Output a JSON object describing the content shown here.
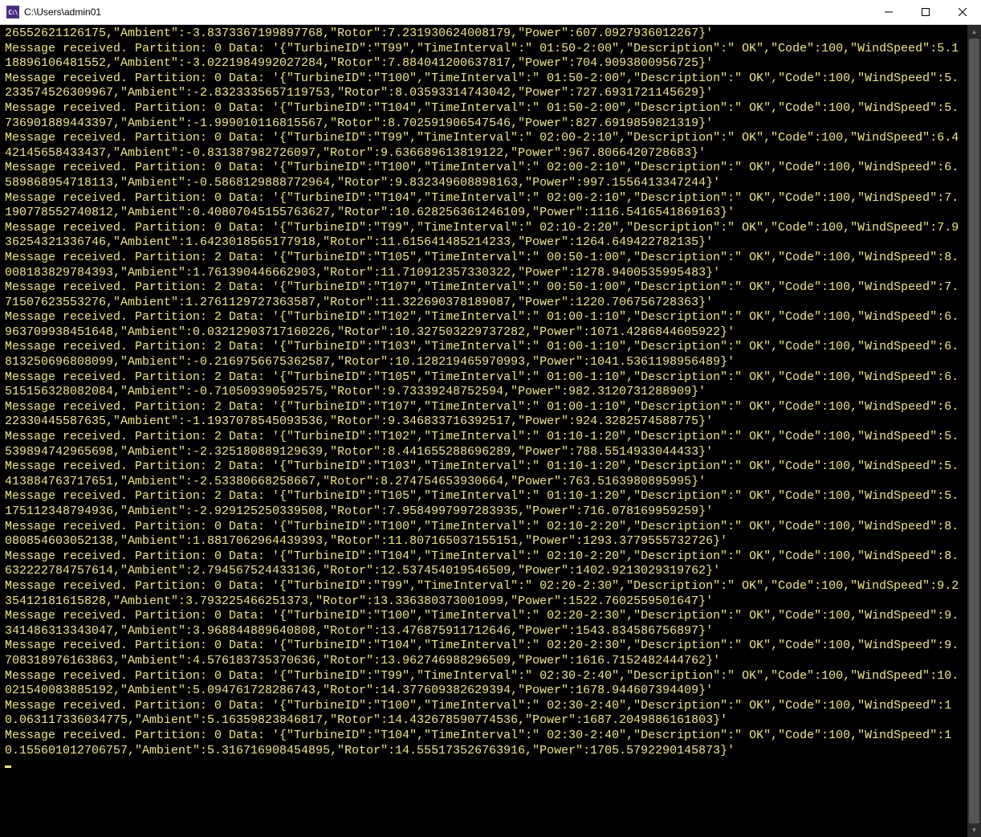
{
  "window": {
    "title": "C:\\Users\\admin01",
    "icon_label": "C:\\"
  },
  "log": {
    "first_fragment": "26552621126175,\"Ambient\":-3.8373367199897768,\"Rotor\":7.231930624008179,\"Power\":607.0927936012267}'",
    "prefix": "Message received. Partition: ",
    "data_label": " Data: '",
    "entries": [
      {
        "partition": 0,
        "payload": {
          "TurbineID": "T99",
          "TimeInterval": " 01:50-2:00",
          "Description": " OK",
          "Code": 100,
          "WindSpeed": 5.118896106481552,
          "Ambient": -3.0221984992027284,
          "Rotor": 7.884041200637817,
          "Power": 704.9093800956725
        }
      },
      {
        "partition": 0,
        "payload": {
          "TurbineID": "T100",
          "TimeInterval": " 01:50-2:00",
          "Description": " OK",
          "Code": 100,
          "WindSpeed": 5.233574526309967,
          "Ambient": -2.8323335657119753,
          "Rotor": 8.03593314743042,
          "Power": 727.6931721145629
        }
      },
      {
        "partition": 0,
        "payload": {
          "TurbineID": "T104",
          "TimeInterval": " 01:50-2:00",
          "Description": " OK",
          "Code": 100,
          "WindSpeed": 5.736901889443397,
          "Ambient": -1.999010116815567,
          "Rotor": 8.702591906547546,
          "Power": 827.6919859821319
        }
      },
      {
        "partition": 0,
        "payload": {
          "TurbineID": "T99",
          "TimeInterval": " 02:00-2:10",
          "Description": " OK",
          "Code": 100,
          "WindSpeed": 6.442145658433437,
          "Ambient": -0.831387982726097,
          "Rotor": 9.636689613819122,
          "Power": 967.8066420728683
        }
      },
      {
        "partition": 0,
        "payload": {
          "TurbineID": "T100",
          "TimeInterval": " 02:00-2:10",
          "Description": " OK",
          "Code": 100,
          "WindSpeed": 6.589868954718113,
          "Ambient": -0.5868129888772964,
          "Rotor": 9.832349608898163,
          "Power": 997.1556413347244
        }
      },
      {
        "partition": 0,
        "payload": {
          "TurbineID": "T104",
          "TimeInterval": " 02:00-2:10",
          "Description": " OK",
          "Code": 100,
          "WindSpeed": 7.190778552740812,
          "Ambient": 0.40807045155763627,
          "Rotor": 10.628256361246109,
          "Power": 1116.5416541869163
        }
      },
      {
        "partition": 0,
        "payload": {
          "TurbineID": "T99",
          "TimeInterval": " 02:10-2:20",
          "Description": " OK",
          "Code": 100,
          "WindSpeed": 7.936254321336746,
          "Ambient": 1.6423018565177918,
          "Rotor": 11.615641485214233,
          "Power": 1264.649422782135
        }
      },
      {
        "partition": 2,
        "payload": {
          "TurbineID": "T105",
          "TimeInterval": " 00:50-1:00",
          "Description": " OK",
          "Code": 100,
          "WindSpeed": 8.008183829784393,
          "Ambient": 1.761390446662903,
          "Rotor": 11.710912357330322,
          "Power": 1278.9400535995483
        }
      },
      {
        "partition": 2,
        "payload": {
          "TurbineID": "T107",
          "TimeInterval": " 00:50-1:00",
          "Description": " OK",
          "Code": 100,
          "WindSpeed": 7.71507623553276,
          "Ambient": 1.2761129727363587,
          "Rotor": 11.322690378189087,
          "Power": 1220.706756728363
        }
      },
      {
        "partition": 2,
        "payload": {
          "TurbineID": "T102",
          "TimeInterval": " 01:00-1:10",
          "Description": " OK",
          "Code": 100,
          "WindSpeed": 6.963709938451648,
          "Ambient": 0.03212903717160226,
          "Rotor": 10.327503229737282,
          "Power": 1071.4286844605922
        }
      },
      {
        "partition": 2,
        "payload": {
          "TurbineID": "T103",
          "TimeInterval": " 01:00-1:10",
          "Description": " OK",
          "Code": 100,
          "WindSpeed": 6.813250696808099,
          "Ambient": -0.2169756675362587,
          "Rotor": 10.128219465970993,
          "Power": 1041.5361198956489
        }
      },
      {
        "partition": 2,
        "payload": {
          "TurbineID": "T105",
          "TimeInterval": " 01:00-1:10",
          "Description": " OK",
          "Code": 100,
          "WindSpeed": 6.515156328082084,
          "Ambient": -0.710509390592575,
          "Rotor": 9.73339248752594,
          "Power": 982.3120731288909
        }
      },
      {
        "partition": 2,
        "payload": {
          "TurbineID": "T107",
          "TimeInterval": " 01:00-1:10",
          "Description": " OK",
          "Code": 100,
          "WindSpeed": 6.22330445587635,
          "Ambient": -1.1937078545093536,
          "Rotor": 9.346833716392517,
          "Power": 924.3282574588775
        }
      },
      {
        "partition": 2,
        "payload": {
          "TurbineID": "T102",
          "TimeInterval": " 01:10-1:20",
          "Description": " OK",
          "Code": 100,
          "WindSpeed": 5.539894742965698,
          "Ambient": -2.325180889129639,
          "Rotor": 8.441655288696289,
          "Power": 788.5514933044433
        }
      },
      {
        "partition": 2,
        "payload": {
          "TurbineID": "T103",
          "TimeInterval": " 01:10-1:20",
          "Description": " OK",
          "Code": 100,
          "WindSpeed": 5.413884763717651,
          "Ambient": -2.53380668258667,
          "Rotor": 8.274754653930664,
          "Power": 763.5163980895995
        }
      },
      {
        "partition": 2,
        "payload": {
          "TurbineID": "T105",
          "TimeInterval": " 01:10-1:20",
          "Description": " OK",
          "Code": 100,
          "WindSpeed": 5.175112348794936,
          "Ambient": -2.929125250339508,
          "Rotor": 7.9584997997283935,
          "Power": 716.078169959259
        }
      },
      {
        "partition": 0,
        "payload": {
          "TurbineID": "T100",
          "TimeInterval": " 02:10-2:20",
          "Description": " OK",
          "Code": 100,
          "WindSpeed": 8.080854603052138,
          "Ambient": 1.8817062964439393,
          "Rotor": 11.807165037155151,
          "Power": 1293.3779555732726
        }
      },
      {
        "partition": 0,
        "payload": {
          "TurbineID": "T104",
          "TimeInterval": " 02:10-2:20",
          "Description": " OK",
          "Code": 100,
          "WindSpeed": 8.632222784757614,
          "Ambient": 2.794567524433136,
          "Rotor": 12.537454019546509,
          "Power": 1402.9213029319762
        }
      },
      {
        "partition": 0,
        "payload": {
          "TurbineID": "T99",
          "TimeInterval": " 02:20-2:30",
          "Description": " OK",
          "Code": 100,
          "WindSpeed": 9.235412181615828,
          "Ambient": 3.793225466251373,
          "Rotor": 13.336380373001099,
          "Power": 1522.7602559501647
        }
      },
      {
        "partition": 0,
        "payload": {
          "TurbineID": "T100",
          "TimeInterval": " 02:20-2:30",
          "Description": " OK",
          "Code": 100,
          "WindSpeed": 9.341486313343047,
          "Ambient": 3.968844889640808,
          "Rotor": 13.476875911712646,
          "Power": 1543.834586756897
        }
      },
      {
        "partition": 0,
        "payload": {
          "TurbineID": "T104",
          "TimeInterval": " 02:20-2:30",
          "Description": " OK",
          "Code": 100,
          "WindSpeed": 9.708318976163863,
          "Ambient": 4.576183735370636,
          "Rotor": 13.962746988296509,
          "Power": 1616.7152482444762
        }
      },
      {
        "partition": 0,
        "payload": {
          "TurbineID": "T99",
          "TimeInterval": " 02:30-2:40",
          "Description": " OK",
          "Code": 100,
          "WindSpeed": 10.021540083885192,
          "Ambient": 5.094761728286743,
          "Rotor": 14.377609382629394,
          "Power": 1678.944607394409
        }
      },
      {
        "partition": 0,
        "payload": {
          "TurbineID": "T100",
          "TimeInterval": " 02:30-2:40",
          "Description": " OK",
          "Code": 100,
          "WindSpeed": 10.063117336034775,
          "Ambient": 5.16359823846817,
          "Rotor": 14.432678590774536,
          "Power": 1687.2049886161803
        }
      },
      {
        "partition": 0,
        "payload": {
          "TurbineID": "T104",
          "TimeInterval": " 02:30-2:40",
          "Description": " OK",
          "Code": 100,
          "WindSpeed": 10.155601012706757,
          "Ambient": 5.316716908454895,
          "Rotor": 14.555173526763916,
          "Power": 1705.5792290145873
        }
      }
    ]
  }
}
